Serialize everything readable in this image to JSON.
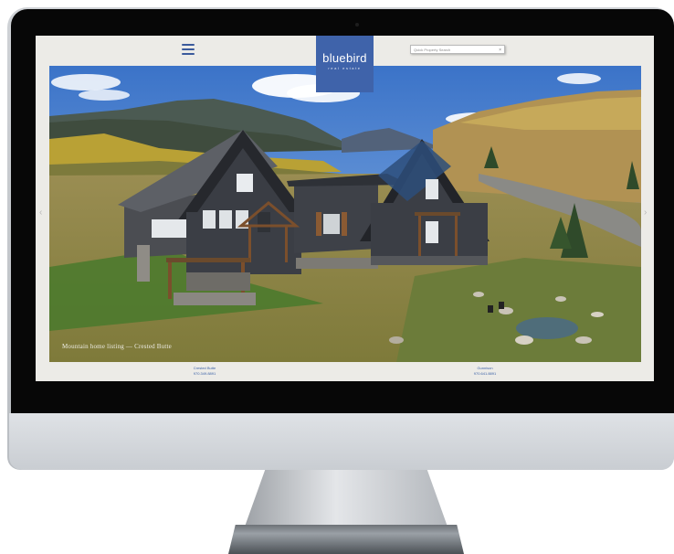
{
  "brand": {
    "name": "bluebird",
    "sub": "real estate",
    "color": "#3f63aa"
  },
  "header": {
    "menu_icon": "hamburger-menu-icon",
    "search_placeholder": "Quick Property Search",
    "search_clear": "×"
  },
  "hero": {
    "caption": "Mountain home listing — Crested Butte",
    "prev_arrow": "‹",
    "next_arrow": "›"
  },
  "offices": [
    {
      "name": "Crested Butte",
      "phone": "970.349.8891"
    },
    {
      "name": "Gunnison",
      "phone": "970.641.8891"
    }
  ]
}
